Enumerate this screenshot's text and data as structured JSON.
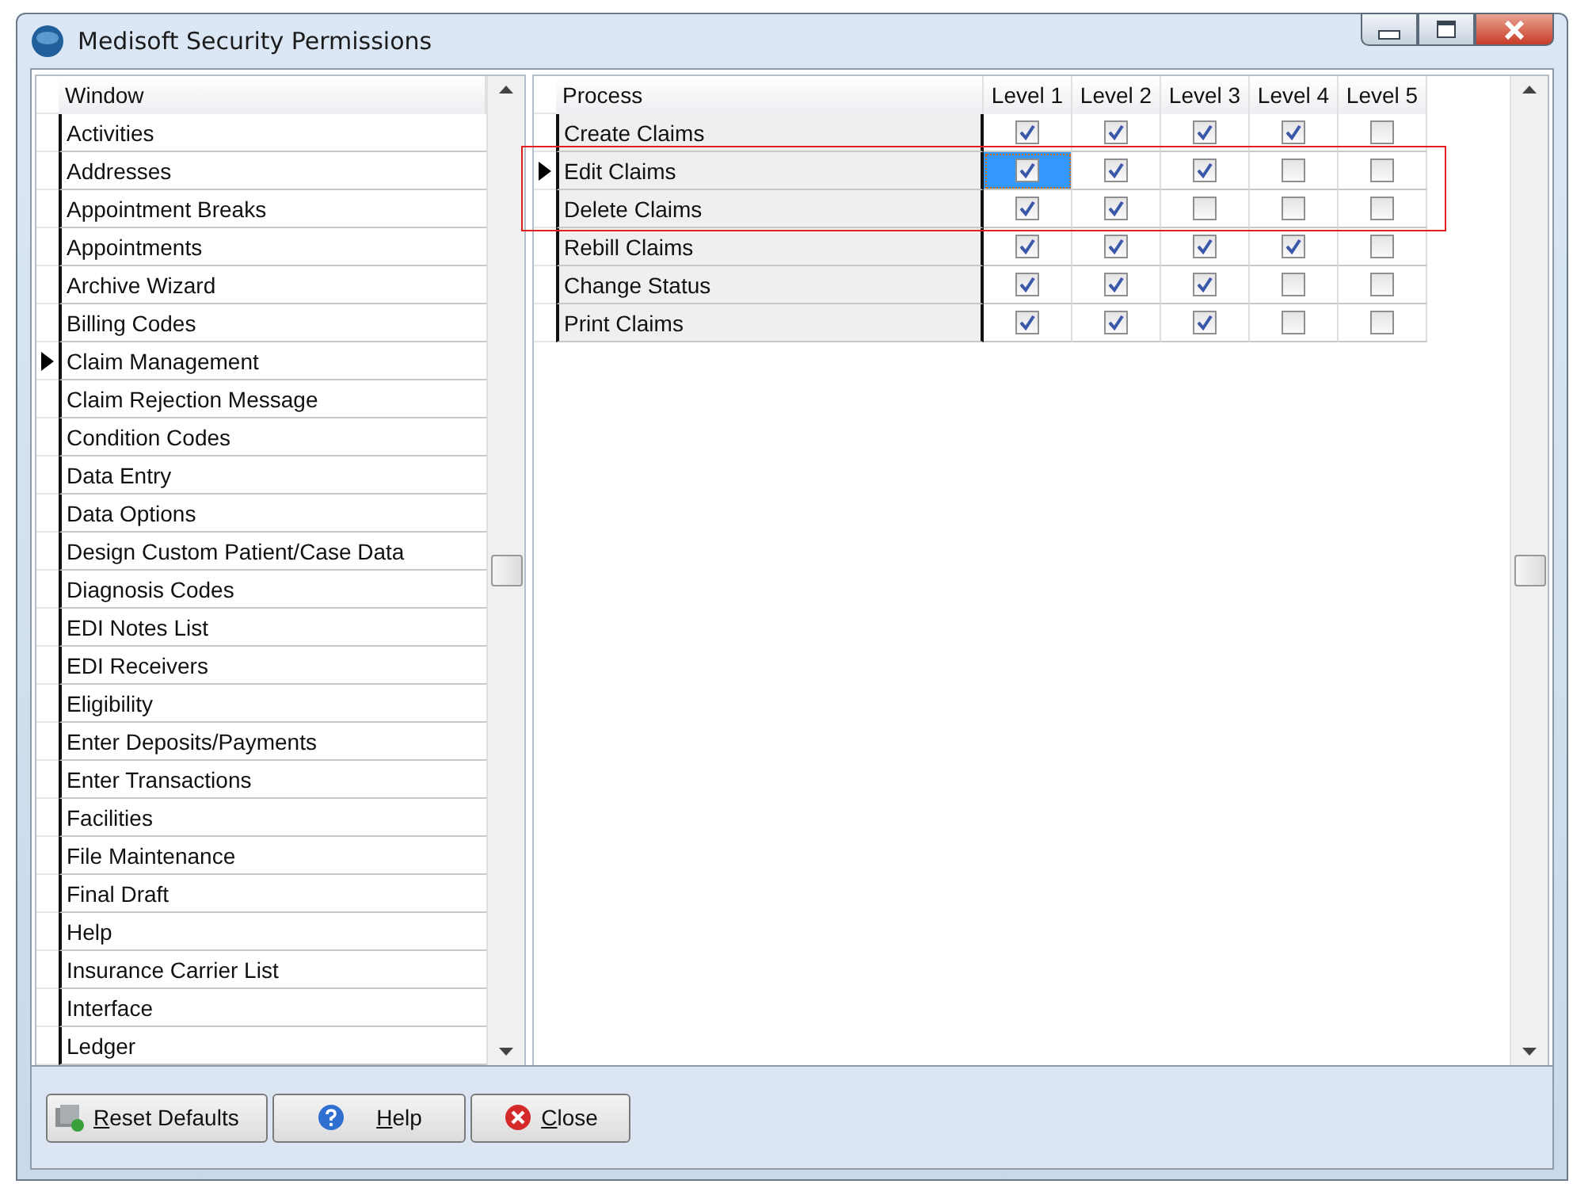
{
  "window": {
    "title": "Medisoft Security Permissions"
  },
  "window_list": {
    "header": "Window",
    "items": [
      {
        "label": "Activities",
        "current": false
      },
      {
        "label": "Addresses",
        "current": false
      },
      {
        "label": "Appointment Breaks",
        "current": false
      },
      {
        "label": "Appointments",
        "current": false
      },
      {
        "label": "Archive Wizard",
        "current": false
      },
      {
        "label": "Billing Codes",
        "current": false
      },
      {
        "label": "Claim Management",
        "current": true
      },
      {
        "label": "Claim Rejection Message",
        "current": false
      },
      {
        "label": "Condition Codes",
        "current": false
      },
      {
        "label": "Data Entry",
        "current": false
      },
      {
        "label": "Data Options",
        "current": false
      },
      {
        "label": "Design Custom Patient/Case Data",
        "current": false
      },
      {
        "label": "Diagnosis Codes",
        "current": false
      },
      {
        "label": "EDI Notes List",
        "current": false
      },
      {
        "label": "EDI Receivers",
        "current": false
      },
      {
        "label": "Eligibility",
        "current": false
      },
      {
        "label": "Enter Deposits/Payments",
        "current": false
      },
      {
        "label": "Enter Transactions",
        "current": false
      },
      {
        "label": "Facilities",
        "current": false
      },
      {
        "label": "File Maintenance",
        "current": false
      },
      {
        "label": "Final Draft",
        "current": false
      },
      {
        "label": "Help",
        "current": false
      },
      {
        "label": "Insurance Carrier List",
        "current": false
      },
      {
        "label": "Interface",
        "current": false
      },
      {
        "label": "Ledger",
        "current": false
      }
    ]
  },
  "permissions": {
    "columns": [
      "Process",
      "Level 1",
      "Level 2",
      "Level 3",
      "Level 4",
      "Level 5"
    ],
    "rows": [
      {
        "process": "Create Claims",
        "current": false,
        "levels": [
          {
            "checked": true,
            "focused": false
          },
          {
            "checked": true,
            "focused": false
          },
          {
            "checked": true,
            "focused": false
          },
          {
            "checked": true,
            "focused": false
          },
          {
            "checked": false,
            "focused": false
          }
        ]
      },
      {
        "process": "Edit Claims",
        "current": true,
        "levels": [
          {
            "checked": true,
            "focused": true
          },
          {
            "checked": true,
            "focused": false
          },
          {
            "checked": true,
            "focused": false
          },
          {
            "checked": false,
            "focused": false
          },
          {
            "checked": false,
            "focused": false
          }
        ]
      },
      {
        "process": "Delete Claims",
        "current": false,
        "levels": [
          {
            "checked": true,
            "focused": false
          },
          {
            "checked": true,
            "focused": false
          },
          {
            "checked": false,
            "focused": false
          },
          {
            "checked": false,
            "focused": false
          },
          {
            "checked": false,
            "focused": false
          }
        ]
      },
      {
        "process": "Rebill Claims",
        "current": false,
        "levels": [
          {
            "checked": true,
            "focused": false
          },
          {
            "checked": true,
            "focused": false
          },
          {
            "checked": true,
            "focused": false
          },
          {
            "checked": true,
            "focused": false
          },
          {
            "checked": false,
            "focused": false
          }
        ]
      },
      {
        "process": "Change Status",
        "current": false,
        "levels": [
          {
            "checked": true,
            "focused": false
          },
          {
            "checked": true,
            "focused": false
          },
          {
            "checked": true,
            "focused": false
          },
          {
            "checked": false,
            "focused": false
          },
          {
            "checked": false,
            "focused": false
          }
        ]
      },
      {
        "process": "Print Claims",
        "current": false,
        "levels": [
          {
            "checked": true,
            "focused": false
          },
          {
            "checked": true,
            "focused": false
          },
          {
            "checked": true,
            "focused": false
          },
          {
            "checked": false,
            "focused": false
          },
          {
            "checked": false,
            "focused": false
          }
        ]
      }
    ]
  },
  "buttons": [
    {
      "kind": "reset",
      "label": "Reset Defaults"
    },
    {
      "kind": "help",
      "label": "Help"
    },
    {
      "kind": "close",
      "label": "Close"
    }
  ]
}
